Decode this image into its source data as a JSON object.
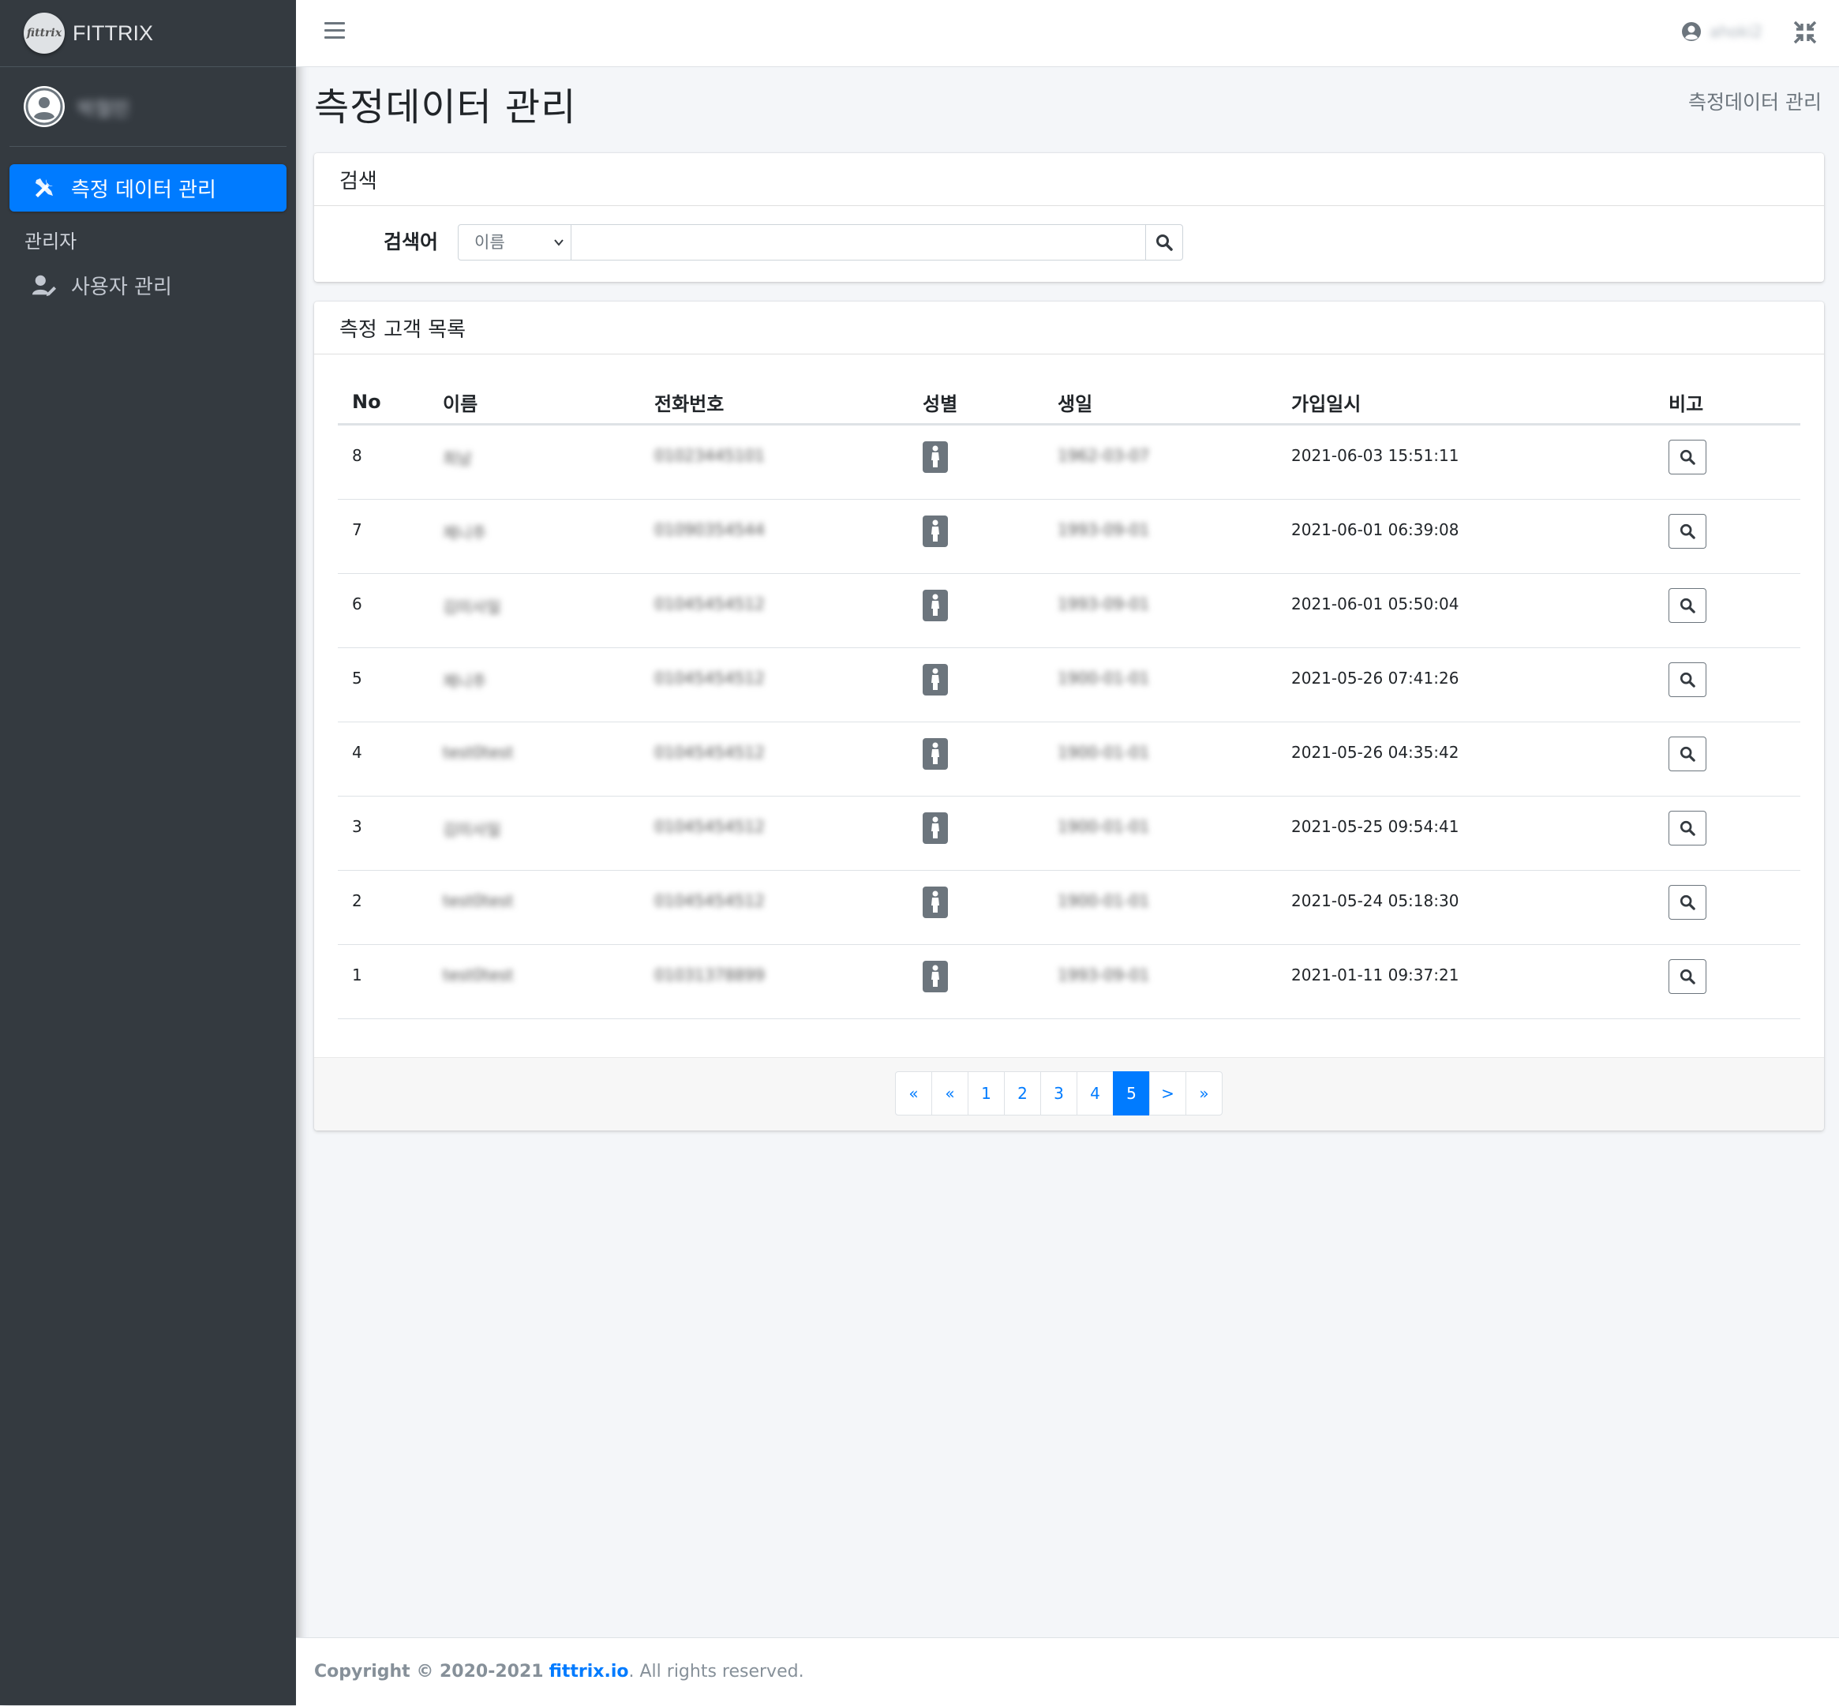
{
  "brand": {
    "name": "FITTRIX",
    "logo_text": "fittrix"
  },
  "user": {
    "name": "박철민"
  },
  "sidebar": {
    "items": [
      {
        "label": "측정 데이터 관리",
        "icon": "tools-icon",
        "active": true
      }
    ],
    "header": "관리자",
    "admin_items": [
      {
        "label": "사용자 관리",
        "icon": "user-edit-icon"
      }
    ]
  },
  "topbar": {
    "user_name": "ahoki2"
  },
  "page": {
    "title": "측정데이터 관리",
    "breadcrumb": "측정데이터 관리"
  },
  "search": {
    "card_title": "검색",
    "label": "검색어",
    "select_value": "이름",
    "input_value": ""
  },
  "list": {
    "card_title": "측정 고객 목록",
    "columns": [
      "No",
      "이름",
      "전화번호",
      "성별",
      "생일",
      "가입일시",
      "비고"
    ],
    "rows": [
      {
        "no": "8",
        "name": "최남",
        "phone": "01023445101",
        "gender": "female",
        "birth": "1962-03-07",
        "joined": "2021-06-03 15:51:11"
      },
      {
        "no": "7",
        "name": "제니주",
        "phone": "01090354544",
        "gender": "female",
        "birth": "1993-09-01",
        "joined": "2021-06-01 06:39:08"
      },
      {
        "no": "6",
        "name": "김미사일",
        "phone": "01045454512",
        "gender": "female",
        "birth": "1993-09-01",
        "joined": "2021-06-01 05:50:04"
      },
      {
        "no": "5",
        "name": "제니주",
        "phone": "01045454512",
        "gender": "female",
        "birth": "1900-01-01",
        "joined": "2021-05-26 07:41:26"
      },
      {
        "no": "4",
        "name": "test0test",
        "phone": "01045454512",
        "gender": "female",
        "birth": "1900-01-01",
        "joined": "2021-05-26 04:35:42"
      },
      {
        "no": "3",
        "name": "김미사일",
        "phone": "01045454512",
        "gender": "female",
        "birth": "1900-01-01",
        "joined": "2021-05-25 09:54:41"
      },
      {
        "no": "2",
        "name": "test0test",
        "phone": "01045454512",
        "gender": "female",
        "birth": "1900-01-01",
        "joined": "2021-05-24 05:18:30"
      },
      {
        "no": "1",
        "name": "test0test",
        "phone": "01031378899",
        "gender": "female",
        "birth": "1993-09-01",
        "joined": "2021-01-11 09:37:21"
      }
    ]
  },
  "pagination": {
    "items": [
      "«",
      "«",
      "1",
      "2",
      "3",
      "4",
      "5",
      ">",
      "»"
    ],
    "active": "5"
  },
  "footer": {
    "prefix": "Copyright © 2020-2021",
    "link": "fittrix.io",
    "suffix": ". All rights reserved."
  },
  "colors": {
    "sidebar": "#343a40",
    "accent": "#007bff",
    "body": "#f4f6f9"
  }
}
